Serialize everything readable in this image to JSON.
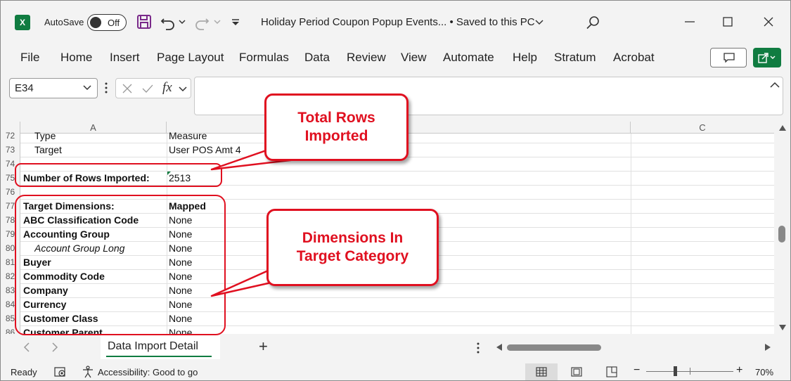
{
  "app": {
    "autosave_label": "AutoSave",
    "autosave_state": "Off",
    "document_title": "Holiday Period Coupon Popup Events...  •  Saved to this PC",
    "accent": "#107c41"
  },
  "ribbon": {
    "tabs": [
      "File",
      "Home",
      "Insert",
      "Page Layout",
      "Formulas",
      "Data",
      "Review",
      "View",
      "Automate",
      "Help",
      "Stratum",
      "Acrobat"
    ]
  },
  "formula_bar": {
    "name_box": "E34",
    "fx": "fx",
    "formula": ""
  },
  "grid": {
    "columns": [
      "A",
      "C"
    ],
    "rows": [
      {
        "num": "72",
        "a": "Type",
        "b": "Measure"
      },
      {
        "num": "73",
        "a": "Target",
        "b": "User POS Amt 4"
      },
      {
        "num": "74",
        "a": "",
        "b": ""
      },
      {
        "num": "75",
        "a": "Number of Rows Imported:",
        "b": "2513"
      },
      {
        "num": "76",
        "a": "",
        "b": ""
      },
      {
        "num": "77",
        "a": "Target Dimensions:",
        "b": "Mapped"
      },
      {
        "num": "78",
        "a": "ABC Classification Code",
        "b": "None"
      },
      {
        "num": "79",
        "a": "Accounting Group",
        "b": "None"
      },
      {
        "num": "80",
        "a": "Account Group Long",
        "b": "None"
      },
      {
        "num": "81",
        "a": "Buyer",
        "b": "None"
      },
      {
        "num": "82",
        "a": "Commodity Code",
        "b": "None"
      },
      {
        "num": "83",
        "a": "Company",
        "b": "None"
      },
      {
        "num": "84",
        "a": "Currency",
        "b": "None"
      },
      {
        "num": "85",
        "a": "Customer Class",
        "b": "None"
      },
      {
        "num": "86",
        "a": "Customer Parent",
        "b": "None"
      }
    ]
  },
  "sheet_tabs": {
    "active": "Data Import Detail",
    "add_symbol": "+"
  },
  "status_bar": {
    "ready": "Ready",
    "accessibility": "Accessibility: Good to go",
    "zoom": "70%"
  },
  "callouts": {
    "rows_imported": "Total Rows Imported",
    "dimensions": "Dimensions In Target Category"
  }
}
